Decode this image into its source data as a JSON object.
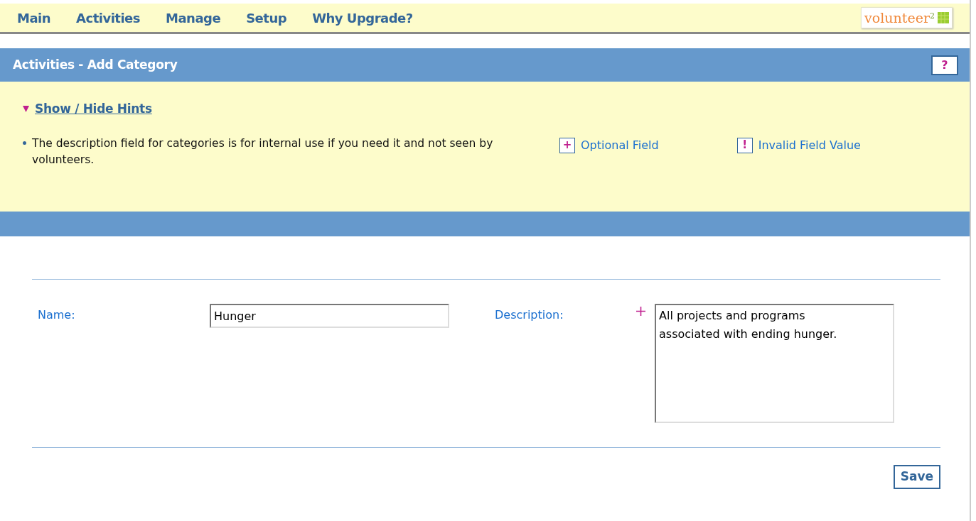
{
  "nav": {
    "items": [
      "Main",
      "Activities",
      "Manage",
      "Setup",
      "Why Upgrade?"
    ],
    "logo": "volunteer$^{2}$"
  },
  "title_bar": {
    "title": "Activities - Add Category",
    "help": "?"
  },
  "hints": {
    "toggle": "Show / Hide Hints",
    "expanded": true,
    "text": "The description field for categories is for internal use if you need it and not seen by volunteers.",
    "legend": [
      {
        "symbol": "+",
        "label": "Optional Field"
      },
      {
        "symbol": "!",
        "label": "Invalid Field Value"
      }
    ]
  },
  "form": {
    "fields": [
      {
        "kind": "text",
        "label": "Name:",
        "optional": false,
        "value": "Hunger"
      },
      {
        "kind": "textarea",
        "label": "Description:",
        "optional": true,
        "value": "All projects and programs associated with ending hunger."
      }
    ],
    "save": "Save"
  }
}
